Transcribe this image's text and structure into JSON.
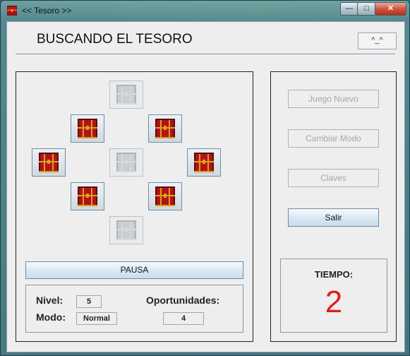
{
  "window": {
    "title": "<< Tesoro >>"
  },
  "header": {
    "title": "BUSCANDO EL TESORO",
    "smile_button": "^_^"
  },
  "board": {
    "chests": [
      {
        "id": "top",
        "enabled": false
      },
      {
        "id": "upper-left",
        "enabled": true
      },
      {
        "id": "upper-right",
        "enabled": true
      },
      {
        "id": "left",
        "enabled": true
      },
      {
        "id": "center",
        "enabled": false
      },
      {
        "id": "right",
        "enabled": true
      },
      {
        "id": "lower-left",
        "enabled": true
      },
      {
        "id": "lower-right",
        "enabled": true
      },
      {
        "id": "bottom",
        "enabled": false
      }
    ],
    "pause_label": "PAUSA"
  },
  "status": {
    "nivel_label": "Nivel:",
    "nivel_value": "5",
    "modo_label": "Modo:",
    "modo_value": "Normal",
    "oportunidades_label": "Oportunidades:",
    "oportunidades_value": "4"
  },
  "menu": {
    "juego_nuevo": "Juego Nuevo",
    "cambiar_modo": "Cambiar Modo",
    "claves": "Claves",
    "salir": "Salir"
  },
  "timer": {
    "label": "TIEMPO:",
    "value": "2"
  },
  "colors": {
    "timer": "#e21b1b",
    "chest_red": "#b3121b",
    "chest_gold": "#d9a21a"
  }
}
